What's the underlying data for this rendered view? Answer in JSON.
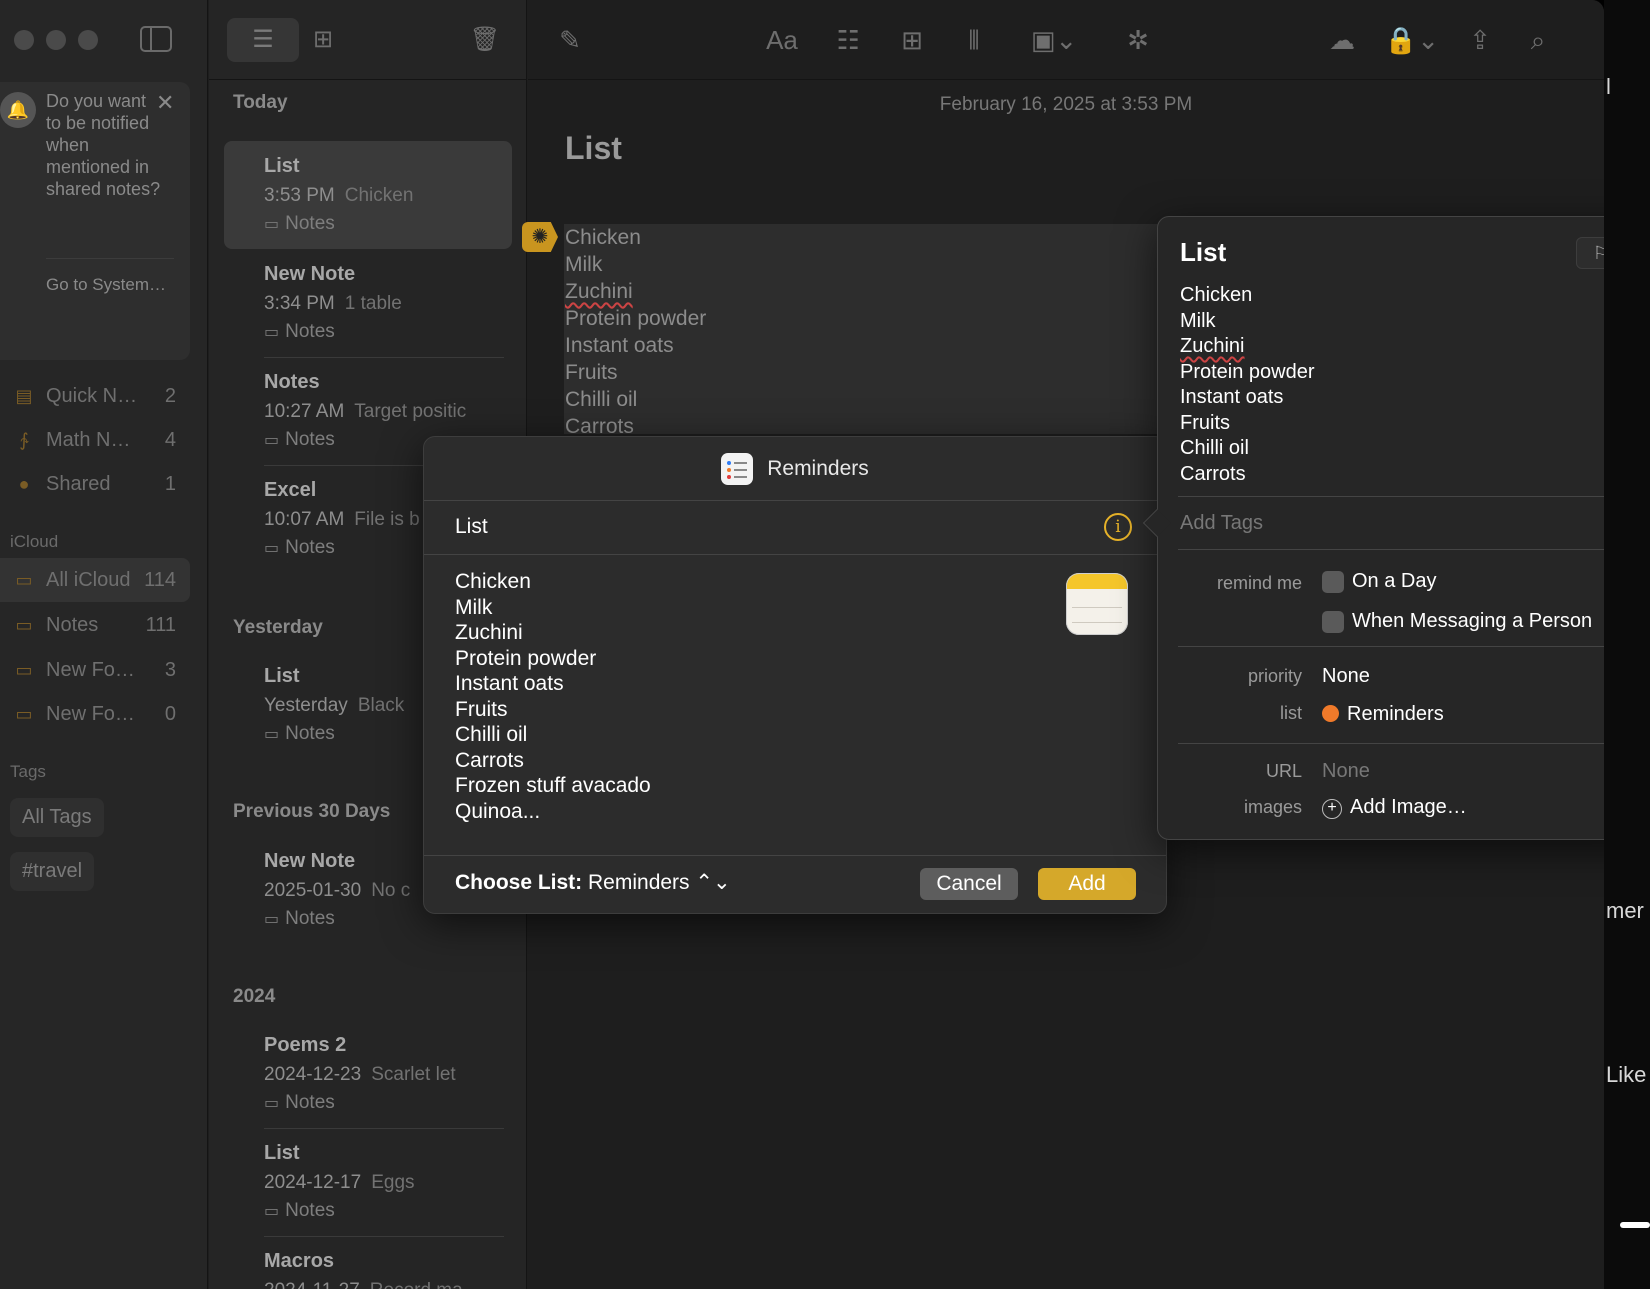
{
  "background": {
    "fragments": [
      "l",
      "mer",
      "Like"
    ]
  },
  "sidebar": {
    "notification": {
      "message": "Do you want to be notified when mentioned in shared notes?",
      "link": "Go to System…",
      "close_glyph": "✕"
    },
    "pinned": [
      {
        "icon": "quick-notes-icon",
        "glyph": "▤",
        "name": "Quick N…",
        "count": "2"
      },
      {
        "icon": "math-notes-icon",
        "glyph": "∱",
        "name": "Math N…",
        "count": "4"
      },
      {
        "icon": "shared-icon",
        "glyph": "●",
        "name": "Shared",
        "count": "1"
      }
    ],
    "icloud_label": "iCloud",
    "folders": [
      {
        "name": "All iCloud",
        "count": "114",
        "selected": true
      },
      {
        "name": "Notes",
        "count": "111"
      },
      {
        "name": "New Fo…",
        "count": "3"
      },
      {
        "name": "New Fo…",
        "count": "0"
      }
    ],
    "tags_label": "Tags",
    "tags": [
      "All Tags",
      "#travel"
    ]
  },
  "notelist": {
    "groups": [
      {
        "header": "Today",
        "notes": [
          {
            "title": "List",
            "time": "3:53 PM",
            "preview": "Chicken",
            "folder": "Notes",
            "selected": true
          },
          {
            "title": "New Note",
            "time": "3:34 PM",
            "preview": "1 table",
            "folder": "Notes"
          },
          {
            "title": "Notes",
            "time": "10:27 AM",
            "preview": "Target positic",
            "folder": "Notes"
          },
          {
            "title": "Excel",
            "time": "10:07 AM",
            "preview": "File is b",
            "folder": "Notes"
          }
        ]
      },
      {
        "header": "Yesterday",
        "notes": [
          {
            "title": "List",
            "time": "Yesterday",
            "preview": "Black",
            "folder": "Notes"
          }
        ]
      },
      {
        "header": "Previous 30 Days",
        "notes": [
          {
            "title": "New Note",
            "time": "2025-01-30",
            "preview": "No c",
            "folder": "Notes"
          }
        ]
      },
      {
        "header": "2024",
        "notes": [
          {
            "title": "Poems 2",
            "time": "2024-12-23",
            "preview": "Scarlet let",
            "folder": "Notes"
          },
          {
            "title": "List",
            "time": "2024-12-17",
            "preview": "Eggs",
            "folder": "Notes"
          },
          {
            "title": "Macros",
            "time": "2024-11-27",
            "preview": "Record ma",
            "folder": "Notes"
          }
        ]
      }
    ]
  },
  "editor": {
    "date": "February 16, 2025 at 3:53 PM",
    "title": "List",
    "lines": [
      "Chicken",
      "Milk",
      "Zuchini",
      "Protein powder",
      "Instant oats",
      "Fruits",
      "Chilli oil",
      "Carrots"
    ]
  },
  "dialog": {
    "app_title": "Reminders",
    "list_title": "List",
    "items": [
      "Chicken",
      "Milk",
      "Zuchini",
      "Protein powder",
      "Instant oats",
      "Fruits",
      "Chilli oil",
      "Carrots",
      "Frozen stuff avacado",
      "Quinoa..."
    ],
    "choose_label": "Choose List:",
    "choose_value": "Reminders",
    "cancel": "Cancel",
    "add": "Add"
  },
  "popover": {
    "title": "List",
    "lines": [
      "Chicken",
      "Milk",
      "Zuchini",
      "Protein powder",
      "Instant oats",
      "Fruits",
      "Chilli oil",
      "Carrots"
    ],
    "tags_placeholder": "Add Tags",
    "remind_label": "remind me",
    "on_a_day": "On a Day",
    "when_messaging": "When Messaging a Person",
    "priority_label": "priority",
    "priority_value": "None",
    "list_label": "list",
    "list_value": "Reminders",
    "list_color": "#f07a2a",
    "url_label": "URL",
    "url_value": "None",
    "images_label": "images",
    "add_image": "Add Image…"
  },
  "colors": {
    "accent": "#d5a82a",
    "info": "#e6b229",
    "folder": "#7a5c25"
  }
}
